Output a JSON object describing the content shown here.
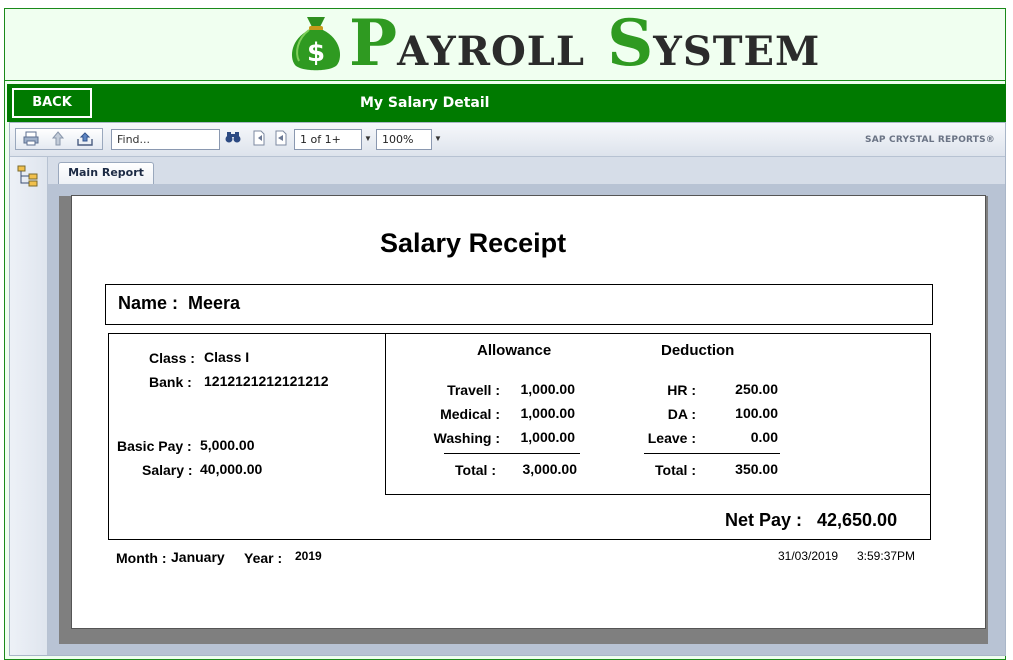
{
  "header": {
    "logo_first_letter": "P",
    "logo_first_rest": "AYROLL",
    "logo_second_letter": "S",
    "logo_second_rest": "YSTEM",
    "logo_bag_symbol": "$",
    "logo_icon": "money-bag-icon"
  },
  "titlebar": {
    "back_label": "BACK",
    "title": "My Salary Detail"
  },
  "toolbar": {
    "icons": [
      "print-icon",
      "export-up-icon",
      "export-icon",
      "find-binoculars-icon",
      "first-page-icon",
      "prev-page-icon"
    ],
    "find_placeholder": "Find...",
    "page_value": "1 of 1+",
    "zoom_value": "100%",
    "brand": "SAP CRYSTAL REPORTS",
    "brand_mark": "®"
  },
  "tabs": [
    {
      "label": "Main Report"
    }
  ],
  "report": {
    "title": "Salary Receipt",
    "name_label": "Name :",
    "name_value": "Meera",
    "class_label": "Class :",
    "class_value": "Class I",
    "bank_label": "Bank :",
    "bank_value": "1212121212121212",
    "basic_pay_label": "Basic Pay :",
    "basic_pay_value": "5,000.00",
    "salary_label": "Salary :",
    "salary_value": "40,000.00",
    "allowance": {
      "heading": "Allowance",
      "items": [
        {
          "label": "Travell :",
          "value": "1,000.00"
        },
        {
          "label": "Medical :",
          "value": "1,000.00"
        },
        {
          "label": "Washing :",
          "value": "1,000.00"
        }
      ],
      "total_label": "Total :",
      "total_value": "3,000.00"
    },
    "deduction": {
      "heading": "Deduction",
      "items": [
        {
          "label": "HR :",
          "value": "250.00"
        },
        {
          "label": "DA :",
          "value": "100.00"
        },
        {
          "label": "Leave :",
          "value": "0.00"
        }
      ],
      "total_label": "Total :",
      "total_value": "350.00"
    },
    "net_pay_label": "Net Pay :",
    "net_pay_value": "42,650.00",
    "month_label": "Month :",
    "month_value": "January",
    "year_label": "Year :",
    "year_value": "2019",
    "print_date": "31/03/2019",
    "print_time": "3:59:37PM"
  },
  "colors": {
    "brand_green": "#007a00",
    "logo_green": "#2f9a21",
    "logo_dark": "#2b2b2b",
    "page_bg": "#f0fff0",
    "viewer_bg": "#d6dde8"
  }
}
